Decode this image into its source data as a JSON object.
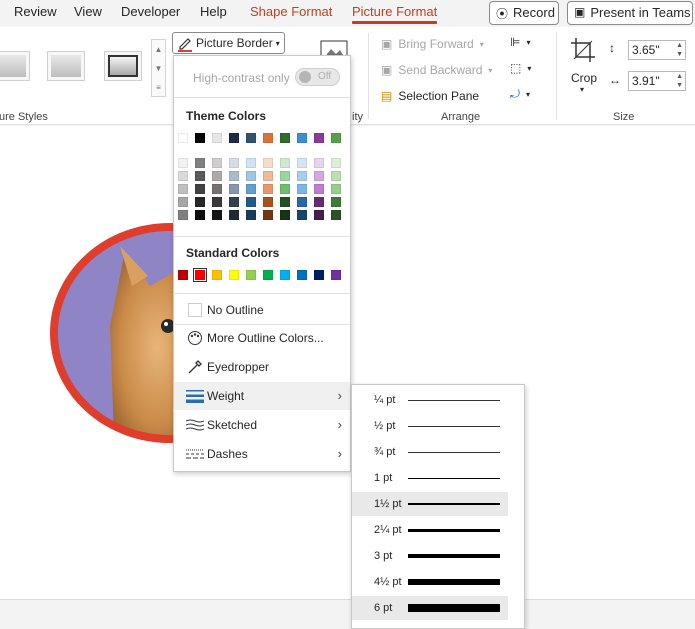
{
  "tabs": {
    "review": "Review",
    "view": "View",
    "developer": "Developer",
    "help": "Help",
    "shape_format": "Shape Format",
    "picture_format": "Picture Format",
    "record": "Record",
    "present": "Present in Teams"
  },
  "ribbon": {
    "picture_styles_label": "ure Styles",
    "picture_border": "Picture Border",
    "partial_ity": "ity",
    "bring_forward": "Bring Forward",
    "send_backward": "Send Backward",
    "selection_pane": "Selection Pane",
    "arrange_label": "Arrange",
    "crop": "Crop",
    "height": "3.65\"",
    "width": "3.91\"",
    "size_label": "Size"
  },
  "menu": {
    "high_contrast": "High-contrast only",
    "toggle_off": "Off",
    "theme_colors_title": "Theme Colors",
    "theme_top": [
      "#ffffff",
      "#000000",
      "#e7e6e6",
      "#1f2a44",
      "#305470",
      "#d9733e",
      "#2e6b2e",
      "#3a8fd1",
      "#8a3a9a",
      "#56a04a"
    ],
    "theme_shades": [
      [
        "#f2f2f2",
        "#d9d9d9",
        "#bfbfbf",
        "#a6a6a6",
        "#808080"
      ],
      [
        "#808080",
        "#595959",
        "#404040",
        "#262626",
        "#0d0d0d"
      ],
      [
        "#d0cece",
        "#aeaaaa",
        "#757171",
        "#3a3838",
        "#171616"
      ],
      [
        "#d6dce4",
        "#adb9ca",
        "#8497b0",
        "#333f4f",
        "#222a35"
      ],
      [
        "#cfe3f2",
        "#9fc6e4",
        "#5f9fd2",
        "#235a86",
        "#173c59"
      ],
      [
        "#f7dccd",
        "#f0b99b",
        "#e8966a",
        "#a8511f",
        "#703614"
      ],
      [
        "#cfe9cf",
        "#9fd39f",
        "#6fbd6f",
        "#225022",
        "#163516"
      ],
      [
        "#d3e6f7",
        "#a7cdef",
        "#7bb4e7",
        "#2468a6",
        "#18456e"
      ],
      [
        "#ead3f0",
        "#d5a7e1",
        "#c07bd2",
        "#672b73",
        "#451d4d"
      ],
      [
        "#ddeed9",
        "#bbdeb3",
        "#99cd8e",
        "#407a37",
        "#2b5125"
      ]
    ],
    "standard_colors_title": "Standard Colors",
    "standard": [
      "#c00000",
      "#ff0000",
      "#ffc000",
      "#ffff00",
      "#92d050",
      "#00b050",
      "#00b0f0",
      "#0070c0",
      "#002060",
      "#7030a0"
    ],
    "no_outline": "No Outline",
    "more_colors": "More Outline Colors...",
    "eyedropper": "Eyedropper",
    "weight": "Weight",
    "sketched": "Sketched",
    "dashes": "Dashes",
    "accent_color": "#c43e1c",
    "border_color": "#e03e2d"
  },
  "weights": [
    {
      "label": "¼ pt",
      "pt": 0.25
    },
    {
      "label": "½ pt",
      "pt": 0.5
    },
    {
      "label": "¾ pt",
      "pt": 0.75
    },
    {
      "label": "1 pt",
      "pt": 1
    },
    {
      "label": "1½ pt",
      "pt": 1.5,
      "selected": true
    },
    {
      "label": "2¼ pt",
      "pt": 2.25
    },
    {
      "label": "3 pt",
      "pt": 3
    },
    {
      "label": "4½ pt",
      "pt": 4.5
    },
    {
      "label": "6 pt",
      "pt": 6,
      "hovered": true
    }
  ]
}
